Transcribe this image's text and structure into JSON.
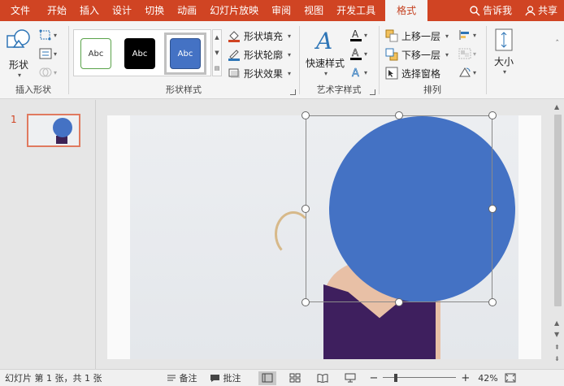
{
  "tabs": {
    "file": "文件",
    "home": "开始",
    "insert": "插入",
    "design": "设计",
    "transitions": "切换",
    "animations": "动画",
    "slideshow": "幻灯片放映",
    "review": "审阅",
    "view": "视图",
    "developer": "开发工具",
    "format": "格式",
    "tellme": "告诉我",
    "share": "共享"
  },
  "ribbon": {
    "insert_shapes": {
      "shapes_label": "形状",
      "group_label": "插入形状"
    },
    "shape_styles": {
      "swatches": [
        "Abc",
        "Abc",
        "Abc"
      ],
      "fill": "形状填充",
      "outline": "形状轮廓",
      "effects": "形状效果",
      "group_label": "形状样式"
    },
    "wordart": {
      "quick_styles": "快速样式",
      "group_label": "艺术字样式"
    },
    "arrange": {
      "bring_forward": "上移一层",
      "send_backward": "下移一层",
      "selection_pane": "选择窗格",
      "group_label": "排列"
    },
    "size": {
      "label": "大小"
    }
  },
  "thumbnails": {
    "slide_number": "1"
  },
  "statusbar": {
    "slide_info": "幻灯片 第 1 张，共 1 张",
    "notes": "备注",
    "comments": "批注",
    "zoom": "42%",
    "zoom_fraction": 0.42
  },
  "colors": {
    "accent": "#d04423",
    "shape_fill": "#4472c4",
    "ribbon_bg": "#f4f4f4"
  }
}
